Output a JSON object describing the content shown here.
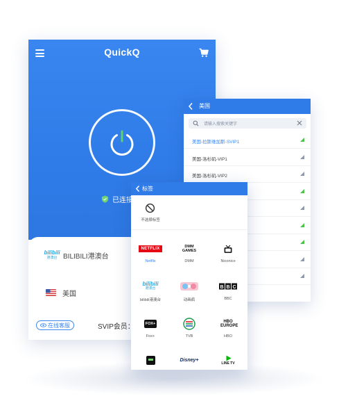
{
  "main": {
    "app_title": "QuickQ",
    "status_text": "已连接",
    "current_tag": "BILIBILI港澳台",
    "current_region": "美国",
    "support_label": "在线客服",
    "svip_label": "SVIP会员："
  },
  "servers": {
    "title": "美国",
    "search_placeholder": "请输入搜索关键字",
    "items": [
      {
        "name": "美国-拉斯维加斯-SVIP1",
        "active": true
      },
      {
        "name": "美国-洛杉矶-VIP1",
        "active": false
      },
      {
        "name": "美国-洛杉矶-VIP2",
        "active": false
      }
    ],
    "signal_colors": [
      "#4cc44a",
      "#8d99aa",
      "#8d99aa",
      "#4cc44a",
      "#8d99aa",
      "#4cc44a",
      "#4cc44a",
      "#8d99aa",
      "#8d99aa"
    ]
  },
  "tags": {
    "title": "标签",
    "no_tag_label": "不选择标签",
    "items": [
      {
        "label": "Netflix",
        "selected": true,
        "logo_text": "NETFLIX"
      },
      {
        "label": "DMM",
        "selected": false,
        "logo_text": "DMM GAMES"
      },
      {
        "label": "Niconico",
        "selected": false,
        "logo_text": ""
      },
      {
        "label": "bilibili港澳台",
        "selected": false,
        "logo_text": "bilibili"
      },
      {
        "label": "动画疯",
        "selected": false,
        "logo_text": ""
      },
      {
        "label": "BBC",
        "selected": false,
        "logo_text": "BBC"
      },
      {
        "label": "Fox+",
        "selected": false,
        "logo_text": "FOX+"
      },
      {
        "label": "TVB",
        "selected": false,
        "logo_text": ""
      },
      {
        "label": "HBO",
        "selected": false,
        "logo_text": "HBO EUROPE"
      },
      {
        "label": "",
        "selected": false,
        "logo_text": ""
      },
      {
        "label": "",
        "selected": false,
        "logo_text": "Disney+"
      },
      {
        "label": "",
        "selected": false,
        "logo_text": "LINE TV"
      }
    ]
  },
  "colors": {
    "brand_blue": "#2f7ce8",
    "netflix_red": "#e50914",
    "signal_green": "#4cc44a"
  }
}
